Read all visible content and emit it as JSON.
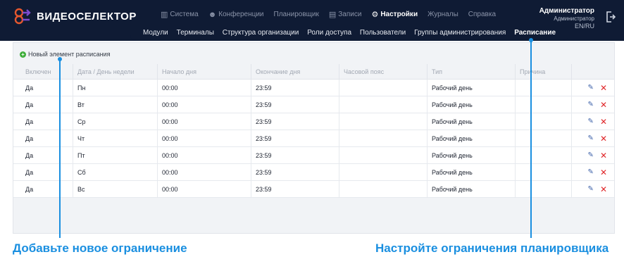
{
  "app": {
    "logo_text": "ВИДЕОСЕЛЕКТОР"
  },
  "top_nav": [
    {
      "label": "Система",
      "icon": "bar-chart-icon"
    },
    {
      "label": "Конференции",
      "icon": "people-icon"
    },
    {
      "label": "Планировщик",
      "icon": ""
    },
    {
      "label": "Записи",
      "icon": "film-icon"
    },
    {
      "label": "Настройки",
      "icon": "gears-icon",
      "active": true
    },
    {
      "label": "Журналы",
      "icon": ""
    },
    {
      "label": "Справка",
      "icon": ""
    }
  ],
  "user": {
    "name": "Администратор",
    "role": "Администратор",
    "lang": "EN/RU"
  },
  "sub_nav": [
    {
      "label": "Модули"
    },
    {
      "label": "Терминалы"
    },
    {
      "label": "Структура организации"
    },
    {
      "label": "Роли доступа"
    },
    {
      "label": "Пользователи"
    },
    {
      "label": "Группы администрирования"
    },
    {
      "label": "Расписание",
      "active": true
    }
  ],
  "schedule": {
    "new_item_label": "Новый элемент расписания",
    "columns": [
      "Включен",
      "Дата / День недели",
      "Начало дня",
      "Окончание дня",
      "Часовой пояс",
      "Тип",
      "Причина"
    ],
    "rows": [
      {
        "enabled": "Да",
        "day": "Пн",
        "start": "00:00",
        "end": "23:59",
        "tz": "",
        "type": "Рабочий день",
        "reason": ""
      },
      {
        "enabled": "Да",
        "day": "Вт",
        "start": "00:00",
        "end": "23:59",
        "tz": "",
        "type": "Рабочий день",
        "reason": ""
      },
      {
        "enabled": "Да",
        "day": "Ср",
        "start": "00:00",
        "end": "23:59",
        "tz": "",
        "type": "Рабочий день",
        "reason": ""
      },
      {
        "enabled": "Да",
        "day": "Чт",
        "start": "00:00",
        "end": "23:59",
        "tz": "",
        "type": "Рабочий день",
        "reason": ""
      },
      {
        "enabled": "Да",
        "day": "Пт",
        "start": "00:00",
        "end": "23:59",
        "tz": "",
        "type": "Рабочий день",
        "reason": ""
      },
      {
        "enabled": "Да",
        "day": "Сб",
        "start": "00:00",
        "end": "23:59",
        "tz": "",
        "type": "Рабочий день",
        "reason": ""
      },
      {
        "enabled": "Да",
        "day": "Вс",
        "start": "00:00",
        "end": "23:59",
        "tz": "",
        "type": "Рабочий день",
        "reason": ""
      }
    ]
  },
  "callouts": {
    "left": "Добавьте новое ограничение",
    "right": "Настройте ограничения планировщика"
  },
  "colors": {
    "header_bg": "#0f1b34",
    "accent_blue": "#1a8fe0",
    "delete_red": "#e0282b",
    "add_green": "#3fae3b"
  }
}
